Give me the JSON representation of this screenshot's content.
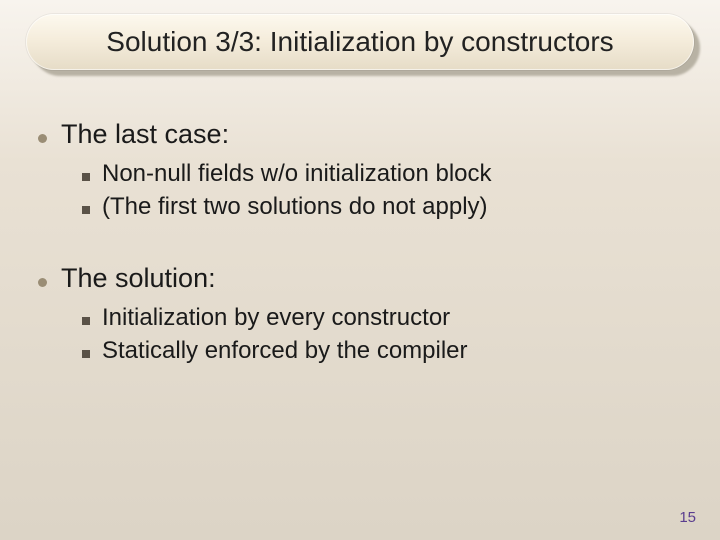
{
  "title": "Solution 3/3: Initialization by constructors",
  "bullets": [
    {
      "label": "The last case:",
      "sub": [
        "Non-null fields w/o initialization block",
        "(The first two solutions do not apply)"
      ]
    },
    {
      "label": "The solution:",
      "sub": [
        "Initialization by every constructor",
        "Statically enforced by the compiler"
      ]
    }
  ],
  "page_number": "15"
}
